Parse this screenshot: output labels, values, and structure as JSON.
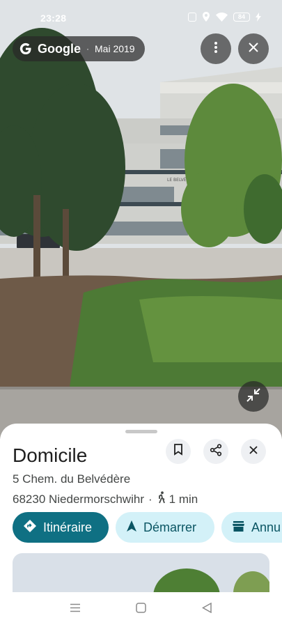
{
  "status_bar": {
    "time": "23:28",
    "battery": "84",
    "icons": [
      "nfc-icon",
      "location-icon",
      "wifi-icon",
      "battery-icon",
      "charging-icon"
    ]
  },
  "streetview": {
    "source_name": "Google",
    "separator": "·",
    "date": "Mai 2019",
    "building_sign": "LE BELVÉDÈRE"
  },
  "place": {
    "title": "Domicile",
    "address": "5 Chem. du Belvédère",
    "city": "68230 Niedermorschwihr",
    "separator": "·",
    "walk_time": "1 min"
  },
  "actions": {
    "directions": "Itinéraire",
    "start": "Démarrer",
    "cancel": "Annu"
  },
  "colors": {
    "primary_button": "#0f7083",
    "secondary_button": "#d3f1f8",
    "secondary_text": "#0a5563",
    "title_text": "#1f1f1f"
  }
}
